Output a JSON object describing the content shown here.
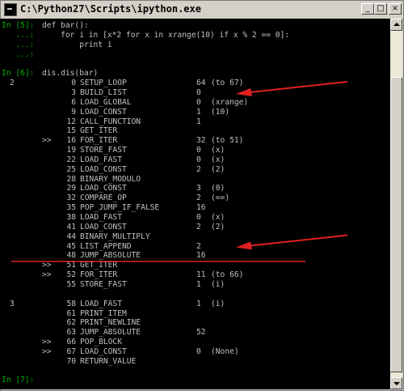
{
  "window": {
    "title": "C:\\Python27\\Scripts\\ipython.exe",
    "controls": [
      "_",
      "□",
      "×"
    ]
  },
  "console": {
    "lines": [
      {
        "kind": "in",
        "prompt": "In [5]: ",
        "text": "def bar():"
      },
      {
        "kind": "cont",
        "prompt": "   ...: ",
        "text": "    for i in [x*2 for x in xrange(10) if x % 2 == 0]:"
      },
      {
        "kind": "cont",
        "prompt": "   ...: ",
        "text": "        print i"
      },
      {
        "kind": "cont",
        "prompt": "   ...: ",
        "text": ""
      },
      {
        "kind": "blank",
        "text": ""
      },
      {
        "kind": "in",
        "prompt": "In [6]: ",
        "text": "dis.dis(bar)"
      },
      {
        "kind": "dis",
        "lineno": "2",
        "jump": "",
        "offset": "0",
        "op": "SETUP_LOOP",
        "arg": "64",
        "note": "(to 67)"
      },
      {
        "kind": "dis",
        "lineno": "",
        "jump": "",
        "offset": "3",
        "op": "BUILD_LIST",
        "arg": "0",
        "note": ""
      },
      {
        "kind": "dis",
        "lineno": "",
        "jump": "",
        "offset": "6",
        "op": "LOAD_GLOBAL",
        "arg": "0",
        "note": "(xrange)"
      },
      {
        "kind": "dis",
        "lineno": "",
        "jump": "",
        "offset": "9",
        "op": "LOAD_CONST",
        "arg": "1",
        "note": "(10)"
      },
      {
        "kind": "dis",
        "lineno": "",
        "jump": "",
        "offset": "12",
        "op": "CALL_FUNCTION",
        "arg": "1",
        "note": ""
      },
      {
        "kind": "dis",
        "lineno": "",
        "jump": "",
        "offset": "15",
        "op": "GET_ITER",
        "arg": "",
        "note": ""
      },
      {
        "kind": "dis",
        "lineno": "",
        "jump": ">>",
        "offset": "16",
        "op": "FOR_ITER",
        "arg": "32",
        "note": "(to 51)"
      },
      {
        "kind": "dis",
        "lineno": "",
        "jump": "",
        "offset": "19",
        "op": "STORE_FAST",
        "arg": "0",
        "note": "(x)"
      },
      {
        "kind": "dis",
        "lineno": "",
        "jump": "",
        "offset": "22",
        "op": "LOAD_FAST",
        "arg": "0",
        "note": "(x)"
      },
      {
        "kind": "dis",
        "lineno": "",
        "jump": "",
        "offset": "25",
        "op": "LOAD_CONST",
        "arg": "2",
        "note": "(2)"
      },
      {
        "kind": "dis",
        "lineno": "",
        "jump": "",
        "offset": "28",
        "op": "BINARY_MODULO",
        "arg": "",
        "note": ""
      },
      {
        "kind": "dis",
        "lineno": "",
        "jump": "",
        "offset": "29",
        "op": "LOAD_CONST",
        "arg": "3",
        "note": "(0)"
      },
      {
        "kind": "dis",
        "lineno": "",
        "jump": "",
        "offset": "32",
        "op": "COMPARE_OP",
        "arg": "2",
        "note": "(==)"
      },
      {
        "kind": "dis",
        "lineno": "",
        "jump": "",
        "offset": "35",
        "op": "POP_JUMP_IF_FALSE",
        "arg": "16",
        "note": ""
      },
      {
        "kind": "dis",
        "lineno": "",
        "jump": "",
        "offset": "38",
        "op": "LOAD_FAST",
        "arg": "0",
        "note": "(x)"
      },
      {
        "kind": "dis",
        "lineno": "",
        "jump": "",
        "offset": "41",
        "op": "LOAD_CONST",
        "arg": "2",
        "note": "(2)"
      },
      {
        "kind": "dis",
        "lineno": "",
        "jump": "",
        "offset": "44",
        "op": "BINARY_MULTIPLY",
        "arg": "",
        "note": ""
      },
      {
        "kind": "dis",
        "lineno": "",
        "jump": "",
        "offset": "45",
        "op": "LIST_APPEND",
        "arg": "2",
        "note": ""
      },
      {
        "kind": "dis",
        "lineno": "",
        "jump": "",
        "offset": "48",
        "op": "JUMP_ABSOLUTE",
        "arg": "16",
        "note": ""
      },
      {
        "kind": "dis",
        "lineno": "",
        "jump": ">>",
        "offset": "51",
        "op": "GET_ITER",
        "arg": "",
        "note": ""
      },
      {
        "kind": "dis",
        "lineno": "",
        "jump": ">>",
        "offset": "52",
        "op": "FOR_ITER",
        "arg": "11",
        "note": "(to 66)"
      },
      {
        "kind": "dis",
        "lineno": "",
        "jump": "",
        "offset": "55",
        "op": "STORE_FAST",
        "arg": "1",
        "note": "(i)"
      },
      {
        "kind": "blank",
        "text": ""
      },
      {
        "kind": "dis",
        "lineno": "3",
        "jump": "",
        "offset": "58",
        "op": "LOAD_FAST",
        "arg": "1",
        "note": "(i)"
      },
      {
        "kind": "dis",
        "lineno": "",
        "jump": "",
        "offset": "61",
        "op": "PRINT_ITEM",
        "arg": "",
        "note": ""
      },
      {
        "kind": "dis",
        "lineno": "",
        "jump": "",
        "offset": "62",
        "op": "PRINT_NEWLINE",
        "arg": "",
        "note": ""
      },
      {
        "kind": "dis",
        "lineno": "",
        "jump": "",
        "offset": "63",
        "op": "JUMP_ABSOLUTE",
        "arg": "52",
        "note": ""
      },
      {
        "kind": "dis",
        "lineno": "",
        "jump": ">>",
        "offset": "66",
        "op": "POP_BLOCK",
        "arg": "",
        "note": ""
      },
      {
        "kind": "dis",
        "lineno": "",
        "jump": ">>",
        "offset": "67",
        "op": "LOAD_CONST",
        "arg": "0",
        "note": "(None)"
      },
      {
        "kind": "dis",
        "lineno": "",
        "jump": "",
        "offset": "70",
        "op": "RETURN_VALUE",
        "arg": "",
        "note": ""
      },
      {
        "kind": "blank",
        "text": ""
      },
      {
        "kind": "in",
        "prompt": "In [7]: ",
        "text": ""
      }
    ]
  },
  "annotations": {
    "arrows": [
      "BUILD_LIST",
      "LIST_APPEND"
    ],
    "underline_after": "JUMP_ABSOLUTE",
    "color": "#e02020"
  },
  "colors": {
    "prompt": "#00b000",
    "text": "#c0c0c0",
    "background": "#000000"
  }
}
